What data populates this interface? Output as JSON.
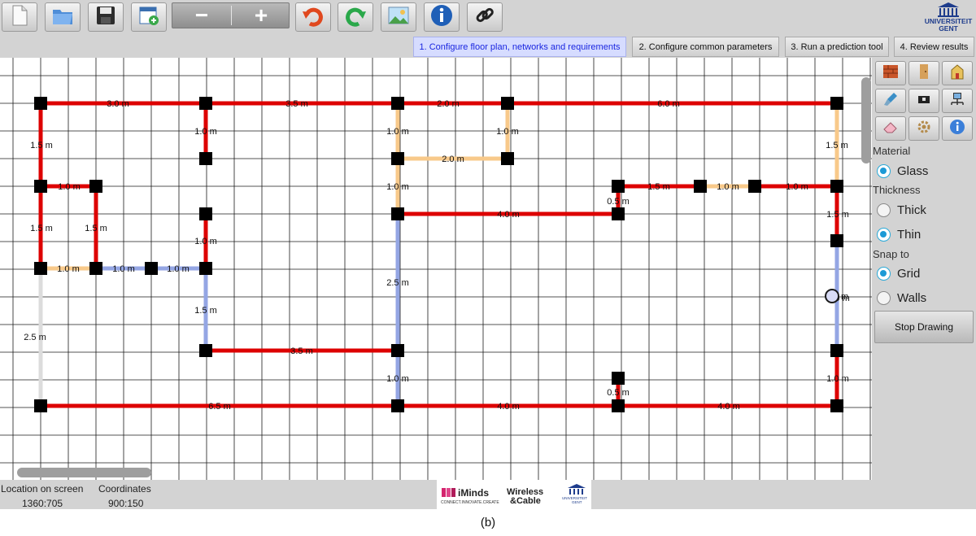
{
  "toolbar": {
    "buttons": [
      {
        "name": "new-file-icon"
      },
      {
        "name": "open-folder-icon"
      },
      {
        "name": "save-icon"
      },
      {
        "name": "add-floor-plan-icon"
      },
      {
        "name": "undo-icon"
      },
      {
        "name": "redo-icon"
      },
      {
        "name": "background-image-icon"
      },
      {
        "name": "info-icon"
      },
      {
        "name": "link-icon"
      }
    ],
    "zoom_out_label": "−",
    "zoom_in_label": "+",
    "logo_line1": "UNIVERSITEIT",
    "logo_line2": "GENT"
  },
  "steps": [
    {
      "label": "1. Configure floor plan, networks and requirements",
      "active": true
    },
    {
      "label": "2. Configure common parameters",
      "active": false
    },
    {
      "label": "3. Run a prediction tool",
      "active": false
    },
    {
      "label": "4. Review results",
      "active": false
    }
  ],
  "side_panel": {
    "tools": [
      "brick-wall-icon",
      "door-icon",
      "building-icon",
      "brush-icon",
      "camera-icon",
      "network-icon",
      "eraser-icon",
      "settings-icon",
      "info-icon"
    ],
    "material_label": "Material",
    "material_option": "Glass",
    "thickness_label": "Thickness",
    "thickness_options": [
      "Thick",
      "Thin"
    ],
    "thickness_selected": "Thin",
    "snap_label": "Snap to",
    "snap_options": [
      "Grid",
      "Walls"
    ],
    "snap_selected": "Grid",
    "stop_button": "Stop Drawing"
  },
  "colors": {
    "concrete_wall": "#dd0000",
    "wood_wall": "#f8c98a",
    "glass_wall": "#94a6e4",
    "drywall_wall": "#dcdcdc",
    "node": "#000000",
    "grid": "#1a1a1a",
    "active_tab_text": "#1a26e0"
  },
  "floor_plan": {
    "walls": [
      {
        "label": "3.0 m"
      },
      {
        "label": "3.5 m"
      },
      {
        "label": "2.0 m"
      },
      {
        "label": "6.0 m"
      },
      {
        "label": "1.5 m"
      },
      {
        "label": "1.0 m"
      },
      {
        "label": "1.0 m"
      },
      {
        "label": "1.0 m"
      },
      {
        "label": "1.5 m"
      },
      {
        "label": "1.0 m"
      },
      {
        "label": "2.0 m"
      },
      {
        "label": "1.0 m"
      },
      {
        "label": "1.5 m"
      },
      {
        "label": "1.5 m"
      },
      {
        "label": "1.0 m"
      },
      {
        "label": "1.5 m"
      },
      {
        "label": "1.0 m"
      },
      {
        "label": "4.0 m"
      },
      {
        "label": "0.5 m"
      },
      {
        "label": "1.0 m"
      },
      {
        "label": "1.5 m"
      },
      {
        "label": "1.0 m"
      },
      {
        "label": "1.0 m"
      },
      {
        "label": "1.0 m"
      },
      {
        "label": "2.5 m"
      },
      {
        "label": "1.5 m"
      },
      {
        "label": "2.5 m"
      },
      {
        "label": "3.5 m"
      },
      {
        "label": "1.0 m"
      },
      {
        "label": "0.5 m"
      },
      {
        "label": "1.0 m"
      },
      {
        "label": "6.5 m"
      },
      {
        "label": "4.0 m"
      },
      {
        "label": "4.0 m"
      },
      {
        "label": "1.0 m"
      }
    ],
    "cursor_label": "m"
  },
  "status": {
    "location_label": "Location on screen",
    "location_value": "1360:705",
    "coordinates_label": "Coordinates",
    "coordinates_value": "900:150"
  },
  "logos": {
    "iminds_name": "iMinds",
    "iminds_tagline": "CONNECT.INNOVATE.CREATE",
    "wireless_line1": "Wireless",
    "wireless_line2": "&Cable",
    "ugent_small1": "UNIVERSITEIT",
    "ugent_small2": "GENT"
  },
  "caption": "(b)"
}
